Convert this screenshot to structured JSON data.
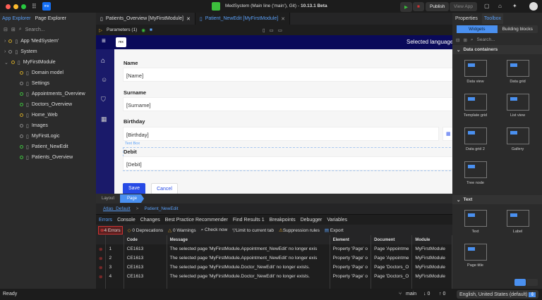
{
  "titlebar": {
    "title": "MedSystem (Main line ('main'), Git) -",
    "version": "10.13.1 Beta",
    "publish": "Publish",
    "view_app": "View App",
    "logo": "mx"
  },
  "left": {
    "tabs": [
      "App Explorer",
      "Page Explorer"
    ],
    "search_placeholder": "Search...",
    "tree": [
      {
        "label": "App 'MedSystem'",
        "status": "#c9a227"
      },
      {
        "label": "System",
        "status": "#888"
      },
      {
        "label": "MyFirstModule",
        "status": "#c9a227"
      }
    ],
    "children": [
      {
        "label": "Domain model",
        "status": "#c9a227"
      },
      {
        "label": "Settings",
        "status": "#888"
      },
      {
        "label": "Appointments_Overview",
        "status": "#3fbf3f"
      },
      {
        "label": "Doctors_Overview",
        "status": "#3fbf3f"
      },
      {
        "label": "Home_Web",
        "status": "#c9a227"
      },
      {
        "label": "Images",
        "status": "#888"
      },
      {
        "label": "MyFirstLogic",
        "status": "#888"
      },
      {
        "label": "Patient_NewEdit",
        "status": "#3fbf3f"
      },
      {
        "label": "Patients_Overview",
        "status": "#3fbf3f"
      }
    ]
  },
  "center": {
    "tabs": [
      "Patients_Overview [MyFirstModule]",
      "Patient_NewEdit [MyFirstModule]"
    ],
    "parameters": "Parameters (1)",
    "page": {
      "logo": "mx",
      "selected_language": "Selected language",
      "name_label": "Name",
      "name_value": "[Name]",
      "surname_label": "Surname",
      "surname_value": "[Surname]",
      "birthday_label": "Birthday",
      "birthday_value": "[Birthday]",
      "textbox_hint": "Text Box",
      "debit_label": "Debit",
      "debit_value": "[Debit]",
      "save": "Save",
      "cancel": "Cancel"
    },
    "layout_tabs": [
      "Layout",
      "Page"
    ],
    "breadcrumb": [
      "Atlas_Default",
      "Patient_NewEdit"
    ]
  },
  "errors": {
    "tabs": [
      "Errors",
      "Console",
      "Changes",
      "Best Practice Recommender",
      "Find Results 1",
      "Breakpoints",
      "Debugger",
      "Variables"
    ],
    "toolbar": {
      "errors": "4 Errors",
      "deprecations": "0 Deprecations",
      "warnings": "0 Warnings",
      "check": "Check now",
      "limit": "Limit to current tab",
      "suppression": "Suppression rules",
      "export": "Export"
    },
    "columns": [
      "",
      "",
      "Code",
      "Message",
      "Element",
      "Document",
      "Module"
    ],
    "rows": [
      [
        "1",
        "CE1613",
        "The selected page 'MyFirstModule.Appointment_NewEdit' no longer exis",
        "Property 'Page' o",
        "Page 'Appointme",
        "MyFirstModule"
      ],
      [
        "2",
        "CE1613",
        "The selected page 'MyFirstModule.Appointment_NewEdit' no longer exis",
        "Property 'Page' o",
        "Page 'Appointme",
        "MyFirstModule"
      ],
      [
        "3",
        "CE1613",
        "The selected page 'MyFirstModule.Doctor_NewEdit' no longer exists.",
        "Property 'Page' o",
        "Page 'Doctors_O",
        "MyFirstModule"
      ],
      [
        "4",
        "CE1613",
        "The selected page 'MyFirstModule.Doctor_NewEdit' no longer exists.",
        "Property 'Page' o",
        "Page 'Doctors_O",
        "MyFirstModule"
      ]
    ]
  },
  "right": {
    "tabs": [
      "Properties",
      "Toolbox"
    ],
    "segments": [
      "Widgets",
      "Building blocks"
    ],
    "search_placeholder": "Search...",
    "sections": [
      "Data containers",
      "Text"
    ],
    "widgets": [
      "Data view",
      "Data grid",
      "Template grid",
      "List view",
      "Data grid 2",
      "Gallery",
      "Tree node"
    ],
    "text_widgets": [
      "Text",
      "Label",
      "Page title"
    ],
    "language": "English, United States (default)"
  },
  "status": {
    "ready": "Ready",
    "branch": "main",
    "down": "0",
    "up": "0"
  }
}
